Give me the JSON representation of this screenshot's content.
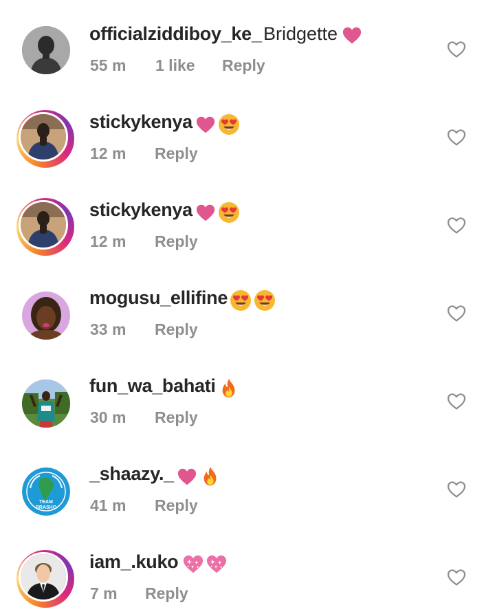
{
  "comments": [
    {
      "username": "officialziddiboy_ke_",
      "text": "Bridgette",
      "time": "55 m",
      "likes": "1 like",
      "reply": "Reply"
    },
    {
      "username": "stickykenya",
      "text": "",
      "time": "12 m",
      "likes": "",
      "reply": "Reply"
    },
    {
      "username": "stickykenya",
      "text": "",
      "time": "12 m",
      "likes": "",
      "reply": "Reply"
    },
    {
      "username": "mogusu_ellifine",
      "text": "",
      "time": "33 m",
      "likes": "",
      "reply": "Reply"
    },
    {
      "username": "fun_wa_bahati",
      "text": "",
      "time": "30 m",
      "likes": "",
      "reply": "Reply"
    },
    {
      "username": "_shaazy._",
      "text": "",
      "time": "41 m",
      "likes": "",
      "reply": "Reply"
    },
    {
      "username": "iam_.kuko",
      "text": "",
      "time": "7 m",
      "likes": "",
      "reply": "Reply"
    }
  ],
  "badge_text": "TEAM BRASHO",
  "icons": {
    "like": "heart-outline-icon",
    "emojis": [
      "red-heart-emoji",
      "heart-eyes-emoji",
      "fire-emoji",
      "sparkling-heart-emoji"
    ]
  },
  "colors": {
    "username": "#262626",
    "meta": "#8e8e8e",
    "heart_emoji": "#e0568f",
    "heart_eyes_face": "#f7b733",
    "fire": "#f26a1b",
    "story_ring_start": "#f58529",
    "story_ring_end": "#dd2a7b"
  }
}
